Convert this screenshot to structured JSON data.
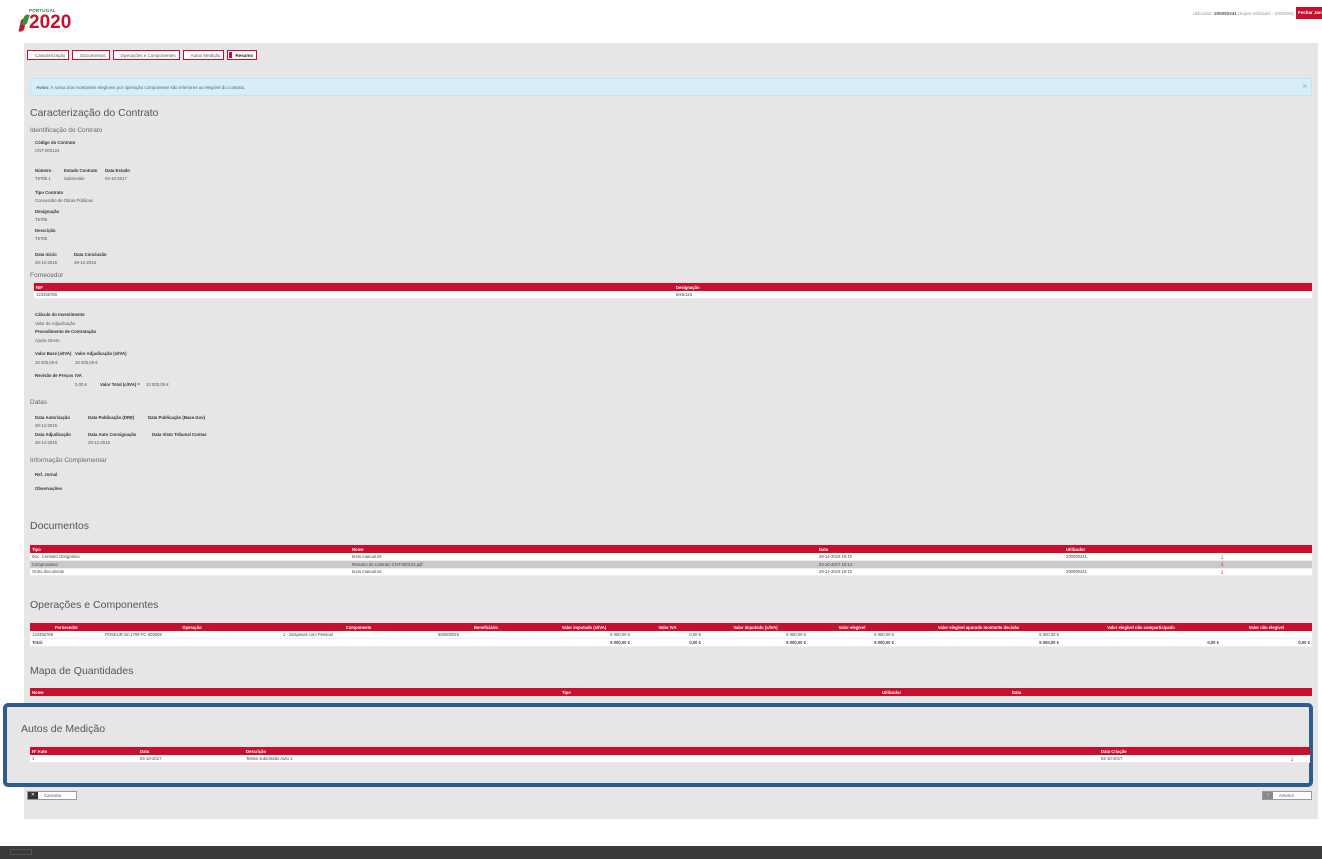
{
  "header": {
    "brand_small": "PORTUGAL",
    "brand_big": "2020",
    "user_label": "Utilizador:",
    "user_id": "200000241",
    "user_role": "(Super-utilizador - 5000006)",
    "logout": "Fechar Janela"
  },
  "tabs": [
    "Caracterização",
    "Documentos",
    "Operações e Componentes",
    "Autos Medição",
    "Resumo"
  ],
  "alert": {
    "strong": "Aviso:",
    "text": "A soma dos montantes elegíveis por operação componente são inferiores ao elegível do contrato.",
    "close": "×"
  },
  "caracterizacao": {
    "title": "Caracterização do Contrato",
    "ident_title": "Identificação do Contrato",
    "codigo_label": "Código do Contrato",
    "codigo_value": "CNT-000124",
    "numero_label": "Número",
    "numero_value": "T6785 1",
    "estado_label": "Estado Contrato",
    "estado_value": "Submetido",
    "data_estado_label": "Data Estado",
    "data_estado_value": "04-10-2017",
    "tipo_label": "Tipo Contrato",
    "tipo_value": "Concessão de Obras Públicas",
    "designacao_label": "Designação",
    "designacao_value": "T6785",
    "descricao_label": "Descrição",
    "descricao_value": "T6785",
    "data_inicio_label": "Data Início",
    "data_inicio_value": "29-12-2016",
    "data_conclusao_label": "Data Conclusão",
    "data_conclusao_value": "29-12-2016"
  },
  "fornecedor": {
    "title": "Fornecedor",
    "headers": [
      "NIF",
      "Designação"
    ],
    "row": [
      "123456789",
      "teste123"
    ],
    "calculo_label": "Cálculo do Investimento",
    "calculo_value": "Valor de Adjudicação",
    "procedimento_label": "Procedimento de Contratação",
    "procedimento_value": "Ajuste Direto",
    "valor_base_label": "Valor Base (s/IVA)",
    "valor_base_value": "10 000,00 €",
    "valor_adj_label": "Valor Adjudicação (s/IVA)",
    "valor_adj_value": "10 000,00 €",
    "revisao_label": "Revisão de Preços",
    "iva_label": "IVA",
    "iva_value": "0,00 €",
    "valor_total_label": "Valor Total (c/IVA) =",
    "valor_total_value": "10 000,00 €"
  },
  "datas": {
    "title": "Datas",
    "autorizacao_label": "Data Autorização",
    "autorizacao_value": "29-12-2016",
    "pub_dre_label": "Data Publicação (DRE)",
    "pub_base_label": "Data Publicação (Base.Gov)",
    "adjudicacao_label": "Data Adjudicação",
    "adjudicacao_value": "29-12-2016",
    "consignacao_label": "Data Auto Consignação",
    "consignacao_value": "29-12-2016",
    "visto_label": "Data Visto Tribunal Contas"
  },
  "info": {
    "title": "Informação Complementar",
    "ref_label": "Ref. Jornal",
    "obs_label": "Observações"
  },
  "documentos": {
    "title": "Documentos",
    "headers": [
      "Tipo",
      "Nome",
      "Data",
      "Utilizador"
    ],
    "rows": [
      [
        "Doc. Contrato Obrigatório",
        "texto manual.txt",
        "29-12-2016 19:10",
        "200000241"
      ],
      [
        "Comprovativo",
        "Resumo do Contrato CNT-000124.pdf",
        "04-10-2017 10:14",
        ""
      ],
      [
        "Outro documento",
        "texto manual.txt",
        "29-12-2016 19:10",
        "200000241"
      ]
    ]
  },
  "operacoes": {
    "title": "Operações e Componentes",
    "headers": [
      "Fornecedor",
      "Operação",
      "Componente",
      "Beneficiário",
      "Valor imputado (s/IVA)",
      "Valor IVA",
      "Valor imputado (c/IVA)",
      "Valor elegível",
      "Valor elegível apurado montante decisão",
      "Valor elegível não comparticipado",
      "Valor não elegível"
    ],
    "row": [
      "123456789",
      "POSEUR-02-1708-FC-000009",
      "1 - Despesas com Pessoal",
      "500000025",
      "5 000,00 €",
      "0,00 €",
      "5 000,00 €",
      "5 000,00 €",
      "5 000,00 €",
      "",
      ""
    ],
    "total": [
      "Total:",
      "",
      "",
      "",
      "5 000,00 €",
      "0,00 €",
      "5 000,00 €",
      "5 000,00 €",
      "5 000,00 €",
      "0,00 €",
      "0,00 €"
    ]
  },
  "mapa": {
    "title": "Mapa de Quantidades",
    "headers": [
      "Nome",
      "Tipo",
      "Utilizador",
      "Data"
    ]
  },
  "autos": {
    "title": "Autos de Medição",
    "headers": [
      "Nº Auto",
      "Data",
      "Descrição",
      "Data Criação"
    ],
    "row": [
      "1",
      "04-10-2017",
      "Testes submissão Auto 1",
      "04-10-2017"
    ]
  },
  "buttons": {
    "cancelar": "Cancelar",
    "anterior": "Anterior"
  }
}
